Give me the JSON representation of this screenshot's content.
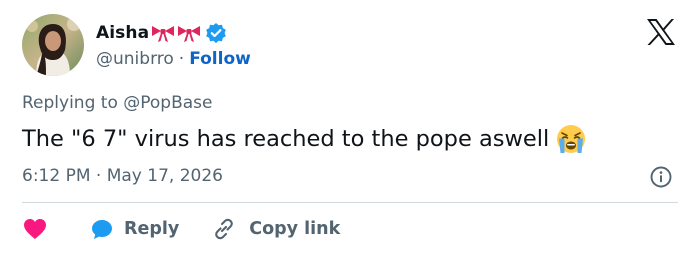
{
  "author": {
    "display_name": "Aisha",
    "name_emoji": "ribbon-bow-pair",
    "verified": true,
    "handle": "@unibrro",
    "separator": "·",
    "follow_label": "Follow"
  },
  "reply_context": {
    "prefix": "Replying to",
    "mention": "@PopBase"
  },
  "tweet": {
    "text": "The \"6 7\" virus has reached to the pope aswell",
    "emoji": "loudly-crying-face",
    "time": "6:12 PM",
    "separator": "·",
    "date": "May 17, 2026"
  },
  "actions": {
    "like_icon": "heart-icon",
    "reply_label": "Reply",
    "copy_link_label": "Copy link"
  },
  "colors": {
    "text": "#0f1419",
    "muted": "#536471",
    "follow_link": "#0f65c7",
    "verified_badge": "#1d9bf0",
    "heart": "#f91880",
    "reply_icon": "#1d9bf0",
    "divider": "#cfd9de"
  }
}
